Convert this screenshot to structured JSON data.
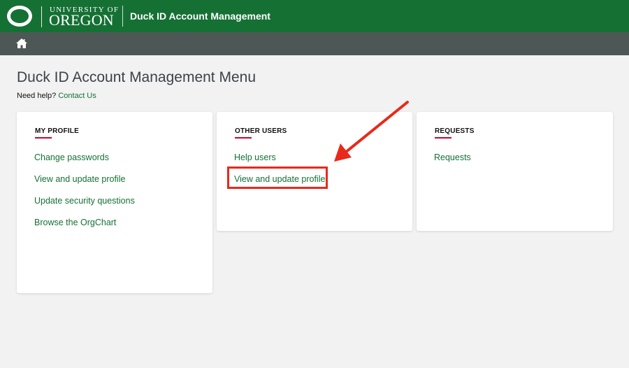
{
  "header": {
    "logo_top": "UNIVERSITY OF",
    "logo_bottom": "OREGON",
    "app_title": "Duck ID Account Management",
    "brand_color": "#157034"
  },
  "nav": {
    "home_icon": "home-icon"
  },
  "main": {
    "heading": "Duck ID Account Management Menu",
    "help_prefix": "Need help?",
    "help_link": "Contact Us"
  },
  "cards": [
    {
      "title": "MY PROFILE",
      "links": [
        "Change passwords",
        "View and update profile",
        "Update security questions",
        "Browse the OrgChart"
      ]
    },
    {
      "title": "OTHER USERS",
      "links": [
        "Help users",
        "View and update profile"
      ]
    },
    {
      "title": "REQUESTS",
      "links": [
        "Requests"
      ]
    }
  ],
  "annotation": {
    "color": "#e8291c",
    "highlighted_item": "View and update profile"
  }
}
